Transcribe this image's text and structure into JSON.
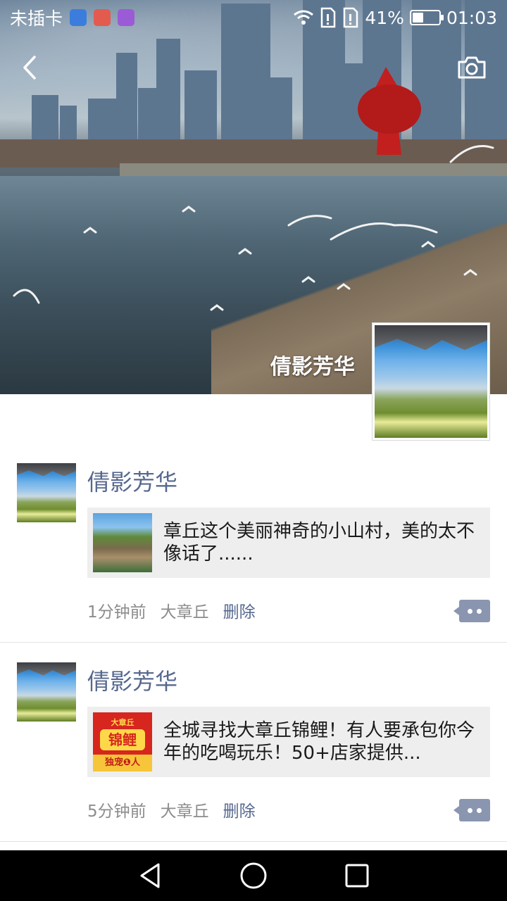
{
  "status_bar": {
    "carrier": "未插卡",
    "battery_percent": "41%",
    "battery_level": 0.41,
    "time": "01:03",
    "icons": [
      "shield-icon",
      "app-red-icon",
      "gallery-icon",
      "wifi-icon",
      "sim-alert-icon",
      "sim-alert-icon",
      "battery-icon"
    ]
  },
  "header": {
    "back_icon": "chevron-left-icon",
    "camera_icon": "camera-icon"
  },
  "profile": {
    "name": "倩影芳华"
  },
  "posts": [
    {
      "author": "倩影芳华",
      "link_text": "章丘这个美丽神奇的小山村，美的太不像话了......",
      "time": "1分钟前",
      "location": "大章丘",
      "delete_label": "删除"
    },
    {
      "author": "倩影芳华",
      "link_text": "全城寻找大章丘锦鲤！有人要承包你今年的吃喝玩乐！50+店家提供...",
      "thumb_texts": {
        "top": "大章丘",
        "mid": "锦鲤",
        "bottom": "独宠❶人"
      },
      "time": "5分钟前",
      "location": "大章丘",
      "delete_label": "删除"
    }
  ],
  "nav_bar": {
    "buttons": [
      "back-triangle-icon",
      "home-circle-icon",
      "recents-square-icon"
    ]
  },
  "colors": {
    "author_link": "#56688f",
    "meta_gray": "#8c8c8c",
    "card_bg": "#eeeeee",
    "comment_btn": "#8a96b0",
    "nav_bg": "#000000"
  }
}
